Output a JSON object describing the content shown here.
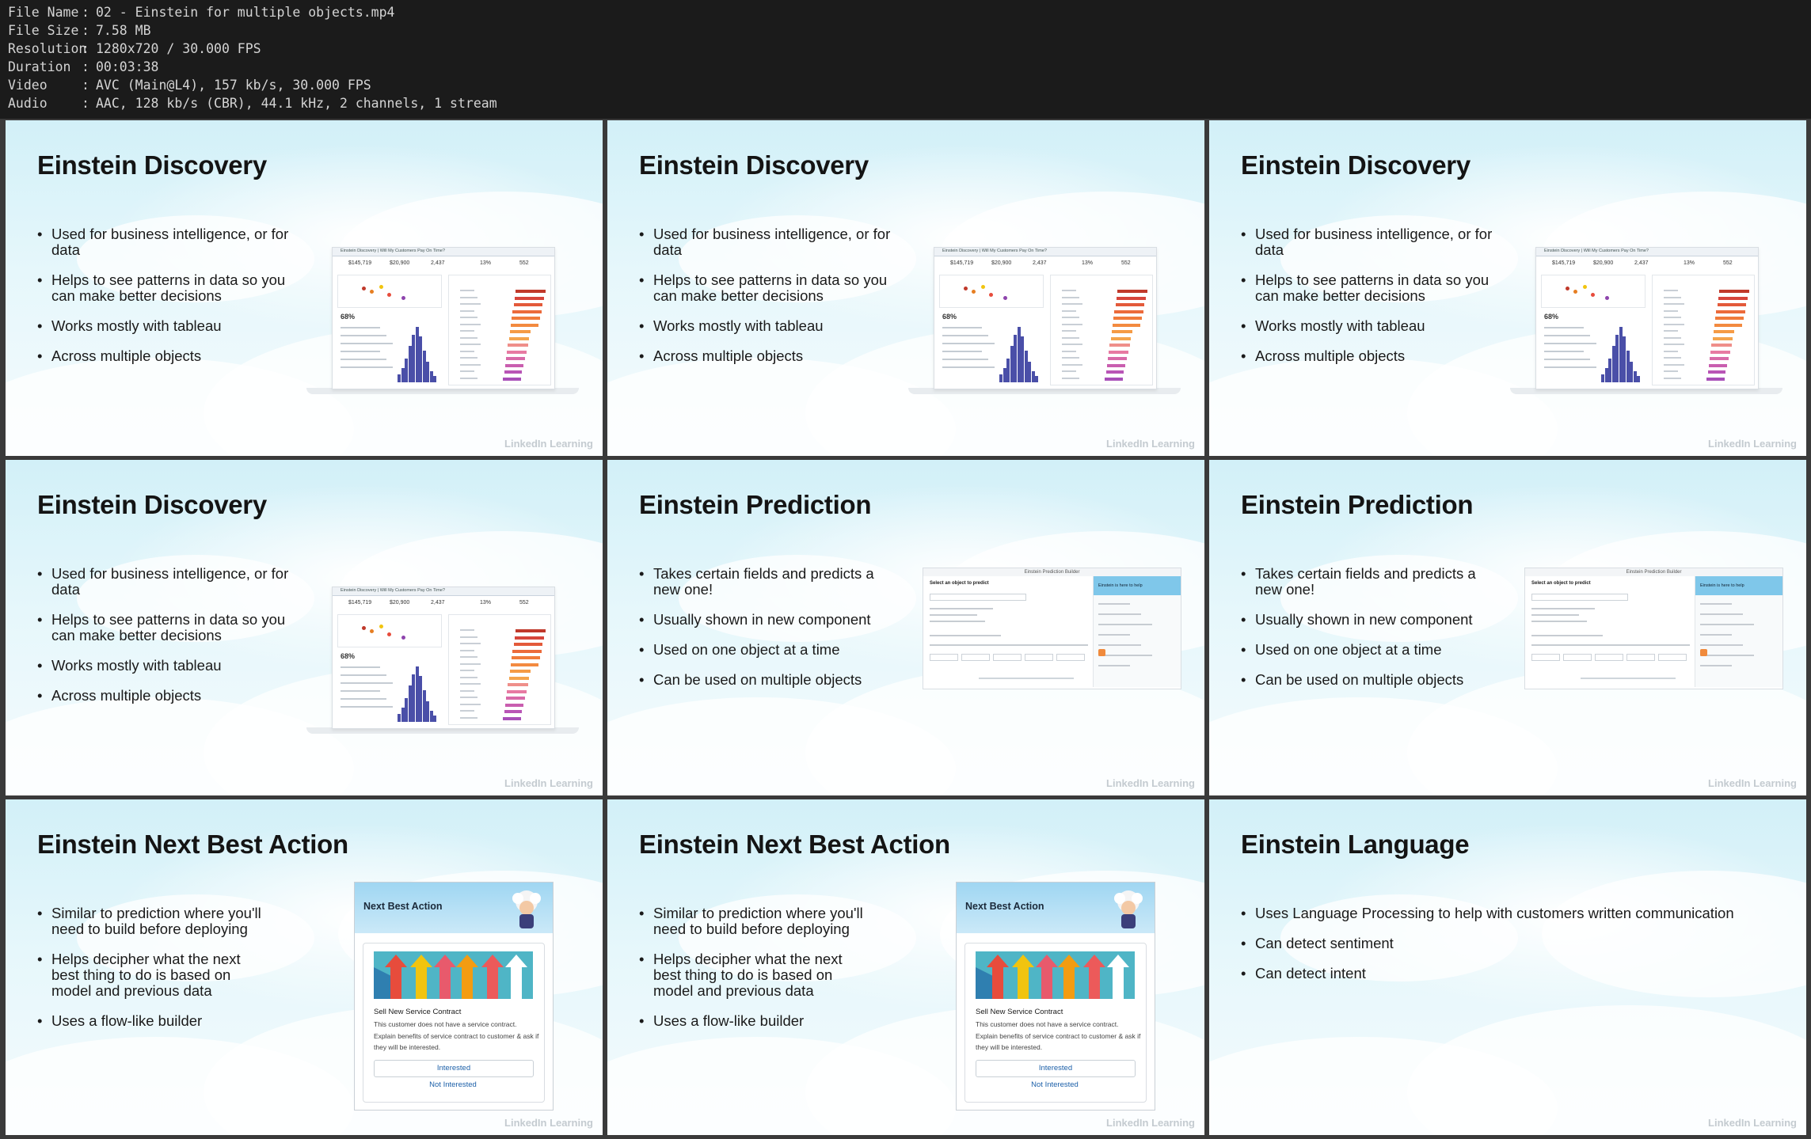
{
  "file_info": [
    {
      "key": "File Name",
      "value": "02 - Einstein for multiple objects.mp4"
    },
    {
      "key": "File Size",
      "value": "7.58 MB"
    },
    {
      "key": "Resolution",
      "value": "1280x720 / 30.000 FPS"
    },
    {
      "key": "Duration",
      "value": "00:03:38"
    },
    {
      "key": "Video",
      "value": "AVC (Main@L4), 157 kb/s, 30.000 FPS"
    },
    {
      "key": "Audio",
      "value": "AAC, 128 kb/s (CBR), 44.1 kHz, 2 channels, 1 stream"
    }
  ],
  "watermark": "LinkedIn Learning",
  "slides": [
    {
      "title": "Einstein Discovery",
      "bullets": [
        "Used for business intelligence, or for data",
        "Helps to see patterns in data so you can make better decisions",
        "Works mostly with tableau",
        "Across multiple objects"
      ],
      "visual": "dashboard"
    },
    {
      "title": "Einstein Discovery",
      "bullets": [
        "Used for business intelligence, or for data",
        "Helps to see patterns in data so you can make better decisions",
        "Works mostly with tableau",
        "Across multiple objects"
      ],
      "visual": "dashboard"
    },
    {
      "title": "Einstein Discovery",
      "bullets": [
        "Used for business intelligence, or for data",
        "Helps to see patterns in data so you can make better decisions",
        "Works mostly with tableau",
        "Across multiple objects"
      ],
      "visual": "dashboard"
    },
    {
      "title": "Einstein Discovery",
      "bullets": [
        "Used for business intelligence, or for data",
        "Helps to see patterns in data so you can make better decisions",
        "Works mostly with tableau",
        "Across multiple objects"
      ],
      "visual": "dashboard"
    },
    {
      "title": "Einstein Prediction",
      "bullets": [
        "Takes certain fields and predicts a new one!",
        "Usually shown in new component",
        "Used on one object at a time",
        "Can be used on multiple objects"
      ],
      "visual": "prediction"
    },
    {
      "title": "Einstein Prediction",
      "bullets": [
        "Takes certain fields and predicts a new one!",
        "Usually shown in new component",
        "Used on one object at a time",
        "Can be used on multiple objects"
      ],
      "visual": "prediction"
    },
    {
      "title": "Einstein Next Best Action",
      "bullets": [
        "Similar to prediction where you'll need to build before deploying",
        "Helps decipher what the next best thing to do is based on model and previous data",
        "Uses a flow-like builder"
      ],
      "visual": "nba"
    },
    {
      "title": "Einstein Next Best Action",
      "bullets": [
        "Similar to prediction where you'll need to build before deploying",
        "Helps decipher what the next best thing to do is based on model and previous data",
        "Uses a flow-like builder"
      ],
      "visual": "nba"
    },
    {
      "title": "Einstein Language",
      "bullets": [
        "Uses Language Processing to help with customers written communication",
        "Can detect sentiment",
        "Can detect intent"
      ],
      "visual": "none"
    }
  ],
  "dashboard": {
    "header": "Einstein Discovery | Will My Customers Pay On Time?",
    "kpis": [
      "$145,719",
      "$20,900",
      "2,437",
      "13%",
      "552"
    ],
    "percent": "68%"
  },
  "prediction": {
    "header": "Einstein Prediction Builder",
    "left_title": "Select an object to predict",
    "side_title": "Einstein is here to help"
  },
  "nba": {
    "header": "Next Best Action",
    "card_title": "Sell New Service Contract",
    "card_desc": "This customer does not have a service contract. Explain benefits of service contract to customer & ask if they will be interested.",
    "primary": "Interested",
    "secondary": "Not Interested"
  },
  "colors": {
    "slide_sky": "#d2f0f8",
    "info_bg": "#1b1b1b",
    "link_blue": "#1b5fa8"
  }
}
